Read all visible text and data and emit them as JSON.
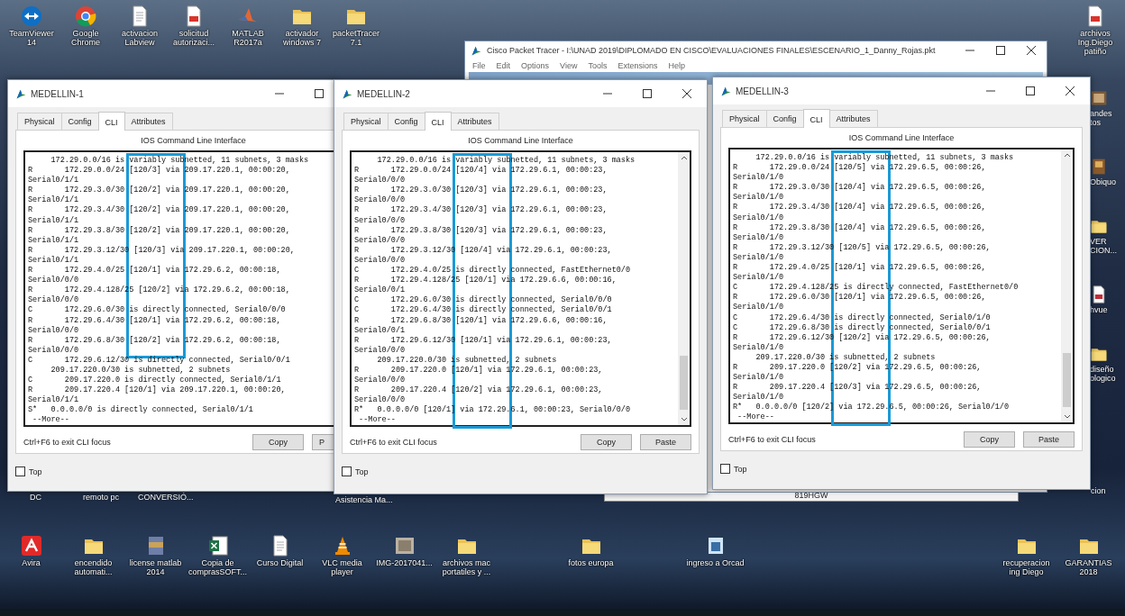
{
  "desktop": {
    "top_icons": [
      {
        "label": "TeamViewer 14",
        "kind": "teamviewer"
      },
      {
        "label": "Google Chrome",
        "kind": "chrome"
      },
      {
        "label": "activacion Labview",
        "kind": "document"
      },
      {
        "label": "solicitud autorizaci...",
        "kind": "pdf"
      },
      {
        "label": "MATLAB R2017a",
        "kind": "matlab"
      },
      {
        "label": "activador windows 7",
        "kind": "folder"
      },
      {
        "label": "packetTracer 7.1",
        "kind": "folder"
      }
    ],
    "top_right_icons": [
      {
        "label": "archivos Ing.Diego patiño",
        "kind": "pdf"
      }
    ],
    "right_edge_icons": [
      {
        "label": "andes tos",
        "kind": "photo"
      },
      {
        "label": "Obiquo",
        "kind": "app"
      },
      {
        "label": "VER CION...",
        "kind": "folder"
      },
      {
        "label": "hvue",
        "kind": "document"
      },
      {
        "label": "diseño ologico",
        "kind": "folder"
      }
    ],
    "partial_labels": [
      "DC",
      "remoto pc",
      "CONVERSIÓ...",
      "Asistencia Ma...",
      "cion"
    ],
    "bottom_icons": [
      {
        "label": "Avira",
        "kind": "avira"
      },
      {
        "label": "encendido automati...",
        "kind": "folder"
      },
      {
        "label": "license matlab 2014",
        "kind": "archive"
      },
      {
        "label": "Copia de comprasSOFT...",
        "kind": "excel"
      },
      {
        "label": "Curso Digital",
        "kind": "document"
      },
      {
        "label": "VLC media player",
        "kind": "vlc"
      },
      {
        "label": "IMG-2017041...",
        "kind": "photo"
      },
      {
        "label": "archivos mac portatiles y ...",
        "kind": "folder"
      },
      {
        "label": "fotos europa",
        "kind": "folder"
      },
      {
        "label": "ingreso a Orcad",
        "kind": "app"
      },
      {
        "label": "recuperacion ing Diego",
        "kind": "folder"
      },
      {
        "label": "GARANTIAS 2018",
        "kind": "folder"
      }
    ]
  },
  "packet_tracer": {
    "title": "Cisco Packet Tracer - I:\\UNAD 2019\\DIPLOMADO EN CISCO\\EVALUACIONES FINALES\\ESCENARIO_1_Danny_Rojas.pkt",
    "menu": [
      "File",
      "Edit",
      "Options",
      "View",
      "Tools",
      "Extensions",
      "Help"
    ]
  },
  "device_label": "819HGW",
  "windows": [
    {
      "title": "MEDELLIN-1",
      "tabs": [
        {
          "label": "Physical",
          "selected": false
        },
        {
          "label": "Config",
          "selected": false
        },
        {
          "label": "CLI",
          "selected": true
        },
        {
          "label": "Attributes",
          "selected": false
        }
      ],
      "cli_header": "IOS Command Line Interface",
      "cli_lines": [
        {
          "text": "     172.29.0.0/16 is variably subnetted, 11 subnets, 3 masks",
          "marked": true
        },
        {
          "text": "R       172.29.0.0/24 [120/3] via 209.17.220.1, 00:00:20,",
          "marked": true
        },
        {
          "text": "Serial0/1/1",
          "marked": true
        },
        {
          "text": "R       172.29.3.0/30 [120/2] via 209.17.220.1, 00:00:20,",
          "marked": true
        },
        {
          "text": "Serial0/1/1",
          "marked": true
        },
        {
          "text": "R       172.29.3.4/30 [120/2] via 209.17.220.1, 00:00:20,",
          "marked": true
        },
        {
          "text": "Serial0/1/1",
          "marked": true
        },
        {
          "text": "R       172.29.3.8/30 [120/2] via 209.17.220.1, 00:00:20,",
          "marked": true
        },
        {
          "text": "Serial0/1/1",
          "marked": true
        },
        {
          "text": "R       172.29.3.12/30 [120/3] via 209.17.220.1, 00:00:20,",
          "marked": true
        },
        {
          "text": "Serial0/1/1",
          "marked": true
        },
        {
          "text": "R       172.29.4.0/25 [120/1] via 172.29.6.2, 00:00:18,",
          "marked": true
        },
        {
          "text": "Serial0/0/0",
          "marked": true
        },
        {
          "text": "R       172.29.4.128/25 [120/2] via 172.29.6.2, 00:00:18,",
          "marked": true
        },
        {
          "text": "Serial0/0/0",
          "marked": true
        },
        {
          "text": "C       172.29.6.0/30 is directly connected, Serial0/0/0",
          "marked": true
        },
        {
          "text": "R       172.29.6.4/30 [120/1] via 172.29.6.2, 00:00:18,",
          "marked": true
        },
        {
          "text": "Serial0/0/0",
          "marked": true
        },
        {
          "text": "R       172.29.6.8/30 [120/2] via 172.29.6.2, 00:00:18,",
          "marked": true
        },
        {
          "text": "Serial0/0/0",
          "marked": true
        },
        {
          "text": "C       172.29.6.12/30 is directly connected, Serial0/0/1",
          "marked": false
        },
        {
          "text": "     209.17.220.0/30 is subnetted, 2 subnets",
          "marked": false
        },
        {
          "text": "C       209.17.220.0 is directly connected, Serial0/1/1",
          "marked": false
        },
        {
          "text": "R       209.17.220.4 [120/1] via 209.17.220.1, 00:00:20,",
          "marked": false
        },
        {
          "text": "Serial0/1/1",
          "marked": false
        },
        {
          "text": "S*   0.0.0.0/0 is directly connected, Serial0/1/1",
          "marked": false
        },
        {
          "text": " --More--",
          "marked": false
        }
      ],
      "footer_hint": "Ctrl+F6 to exit CLI focus",
      "buttons": [
        "Copy",
        "P"
      ],
      "top_checkbox": {
        "label": "Top",
        "checked": false
      }
    },
    {
      "title": "MEDELLIN-2",
      "tabs": [
        {
          "label": "Physical",
          "selected": false
        },
        {
          "label": "Config",
          "selected": false
        },
        {
          "label": "CLI",
          "selected": true
        },
        {
          "label": "Attributes",
          "selected": false
        }
      ],
      "cli_header": "IOS Command Line Interface",
      "cli_lines": [
        {
          "text": "     172.29.0.0/16 is variably subnetted, 11 subnets, 3 masks",
          "marked": true
        },
        {
          "text": "R       172.29.0.0/24 [120/4] via 172.29.6.1, 00:00:23,",
          "marked": true
        },
        {
          "text": "Serial0/0/0",
          "marked": true
        },
        {
          "text": "R       172.29.3.0/30 [120/3] via 172.29.6.1, 00:00:23,",
          "marked": true
        },
        {
          "text": "Serial0/0/0",
          "marked": true
        },
        {
          "text": "R       172.29.3.4/30 [120/3] via 172.29.6.1, 00:00:23,",
          "marked": true
        },
        {
          "text": "Serial0/0/0",
          "marked": true
        },
        {
          "text": "R       172.29.3.8/30 [120/3] via 172.29.6.1, 00:00:23,",
          "marked": true
        },
        {
          "text": "Serial0/0/0",
          "marked": true
        },
        {
          "text": "R       172.29.3.12/30 [120/4] via 172.29.6.1, 00:00:23,",
          "marked": true
        },
        {
          "text": "Serial0/0/0",
          "marked": true
        },
        {
          "text": "C       172.29.4.0/25 is directly connected, FastEthernet0/0",
          "marked": true
        },
        {
          "text": "R       172.29.4.128/25 [120/1] via 172.29.6.6, 00:00:16,",
          "marked": true
        },
        {
          "text": "Serial0/0/1",
          "marked": true
        },
        {
          "text": "C       172.29.6.0/30 is directly connected, Serial0/0/0",
          "marked": true
        },
        {
          "text": "C       172.29.6.4/30 is directly connected, Serial0/0/1",
          "marked": true
        },
        {
          "text": "R       172.29.6.8/30 [120/1] via 172.29.6.6, 00:00:16,",
          "marked": true
        },
        {
          "text": "Serial0/0/1",
          "marked": true
        },
        {
          "text": "R       172.29.6.12/30 [120/1] via 172.29.6.1, 00:00:23,",
          "marked": true
        },
        {
          "text": "Serial0/0/0",
          "marked": true
        },
        {
          "text": "     209.17.220.0/30 is subnetted, 2 subnets",
          "marked": true
        },
        {
          "text": "R       209.17.220.0 [120/1] via 172.29.6.1, 00:00:23,",
          "marked": true
        },
        {
          "text": "Serial0/0/0",
          "marked": true
        },
        {
          "text": "R       209.17.220.4 [120/2] via 172.29.6.1, 00:00:23,",
          "marked": true
        },
        {
          "text": "Serial0/0/0",
          "marked": true
        },
        {
          "text": "R*   0.0.0.0/0 [120/1] via 172.29.6.1, 00:00:23, Serial0/0/0",
          "marked": true
        },
        {
          "text": " --More--",
          "marked": true
        }
      ],
      "footer_hint": "Ctrl+F6 to exit CLI focus",
      "buttons": [
        "Copy",
        "Paste"
      ],
      "top_checkbox": {
        "label": "Top",
        "checked": false
      }
    },
    {
      "title": "MEDELLIN-3",
      "tabs": [
        {
          "label": "Physical",
          "selected": false
        },
        {
          "label": "Config",
          "selected": false
        },
        {
          "label": "CLI",
          "selected": true
        },
        {
          "label": "Attributes",
          "selected": false
        }
      ],
      "cli_header": "IOS Command Line Interface",
      "cli_lines": [
        {
          "text": "     172.29.0.0/16 is variably subnetted, 11 subnets, 3 masks",
          "marked": true
        },
        {
          "text": "R       172.29.0.0/24 [120/5] via 172.29.6.5, 00:00:26,",
          "marked": true
        },
        {
          "text": "Serial0/1/0",
          "marked": true
        },
        {
          "text": "R       172.29.3.0/30 [120/4] via 172.29.6.5, 00:00:26,",
          "marked": true
        },
        {
          "text": "Serial0/1/0",
          "marked": true
        },
        {
          "text": "R       172.29.3.4/30 [120/4] via 172.29.6.5, 00:00:26,",
          "marked": true
        },
        {
          "text": "Serial0/1/0",
          "marked": true
        },
        {
          "text": "R       172.29.3.8/30 [120/4] via 172.29.6.5, 00:00:26,",
          "marked": true
        },
        {
          "text": "Serial0/1/0",
          "marked": true
        },
        {
          "text": "R       172.29.3.12/30 [120/5] via 172.29.6.5, 00:00:26,",
          "marked": true
        },
        {
          "text": "Serial0/1/0",
          "marked": true
        },
        {
          "text": "R       172.29.4.0/25 [120/1] via 172.29.6.5, 00:00:26,",
          "marked": true
        },
        {
          "text": "Serial0/1/0",
          "marked": true
        },
        {
          "text": "C       172.29.4.128/25 is directly connected, FastEthernet0/0",
          "marked": true
        },
        {
          "text": "R       172.29.6.0/30 [120/1] via 172.29.6.5, 00:00:26,",
          "marked": true
        },
        {
          "text": "Serial0/1/0",
          "marked": true
        },
        {
          "text": "C       172.29.6.4/30 is directly connected, Serial0/1/0",
          "marked": true
        },
        {
          "text": "C       172.29.6.8/30 is directly connected, Serial0/0/1",
          "marked": true
        },
        {
          "text": "R       172.29.6.12/30 [120/2] via 172.29.6.5, 00:00:26,",
          "marked": true
        },
        {
          "text": "Serial0/1/0",
          "marked": true
        },
        {
          "text": "     209.17.220.0/30 is subnetted, 2 subnets",
          "marked": true
        },
        {
          "text": "R       209.17.220.0 [120/2] via 172.29.6.5, 00:00:26,",
          "marked": true
        },
        {
          "text": "Serial0/1/0",
          "marked": true
        },
        {
          "text": "R       209.17.220.4 [120/3] via 172.29.6.5, 00:00:26,",
          "marked": true
        },
        {
          "text": "Serial0/1/0",
          "marked": true
        },
        {
          "text": "R*   0.0.0.0/0 [120/2] via 172.29.6.5, 00:00:26, Serial0/1/0",
          "marked": true
        },
        {
          "text": " --More--",
          "marked": true
        }
      ],
      "footer_hint": "Ctrl+F6 to exit CLI focus",
      "buttons": [
        "Copy",
        "Paste"
      ],
      "top_checkbox": {
        "label": "Top",
        "checked": false
      }
    }
  ]
}
